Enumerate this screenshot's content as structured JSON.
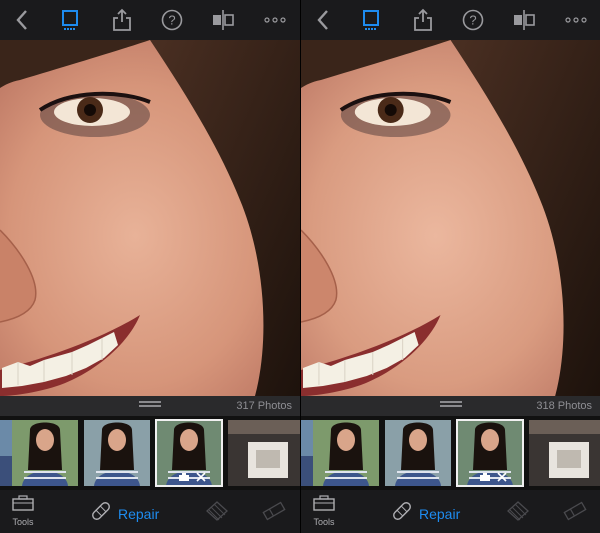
{
  "screens": [
    {
      "toolbar": {
        "back": "back-icon",
        "view": "device-view-icon",
        "share": "share-icon",
        "help": "help-icon",
        "compare": "compare-icon",
        "more": "more-icon"
      },
      "photo_count": "317 Photos",
      "bottom": {
        "tools_label": "Tools",
        "repair_label": "Repair"
      }
    },
    {
      "toolbar": {
        "back": "back-icon",
        "view": "device-view-icon",
        "share": "share-icon",
        "help": "help-icon",
        "compare": "compare-icon",
        "more": "more-icon"
      },
      "photo_count": "318 Photos",
      "bottom": {
        "tools_label": "Tools",
        "repair_label": "Repair"
      }
    }
  ],
  "colors": {
    "accent": "#1e8cf0",
    "toolbar_bg": "#1a1a1c",
    "icon_gray": "#8e8e93"
  }
}
